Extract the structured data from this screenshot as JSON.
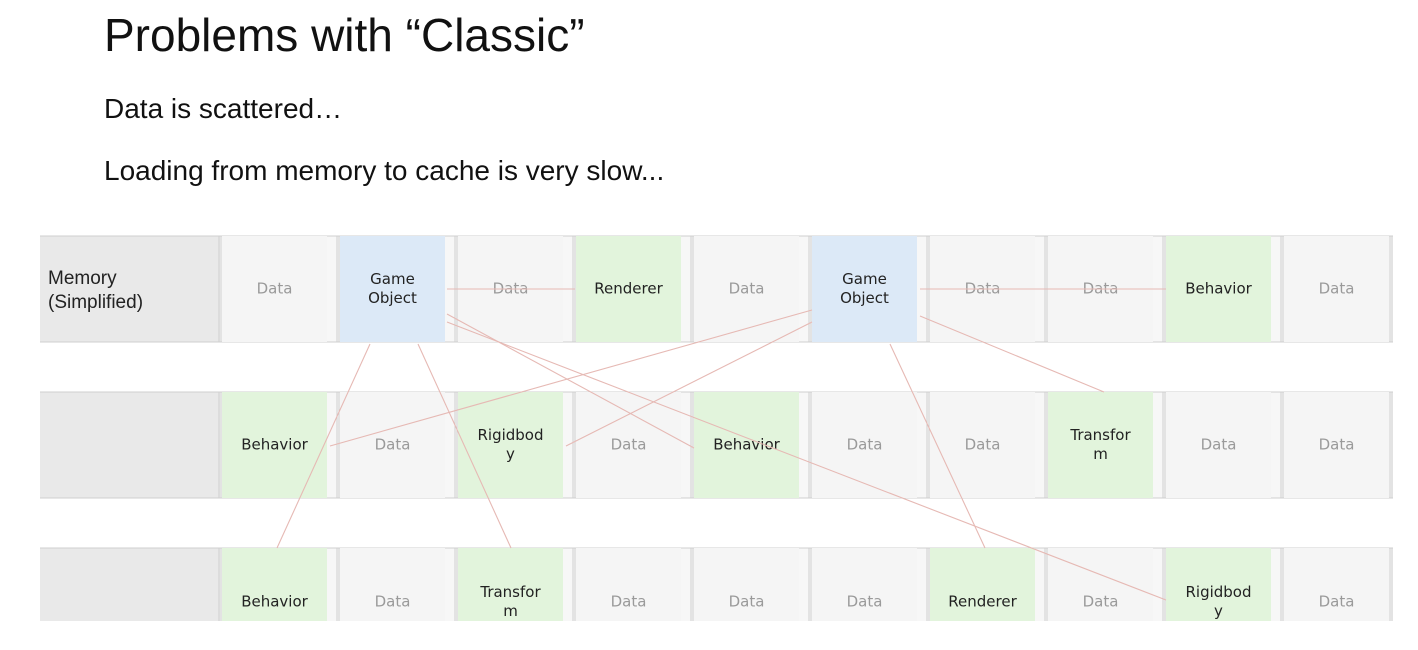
{
  "slide": {
    "title": "Problems with “Classic”",
    "bullets": [
      "Data is scattered…",
      "Loading from memory to cache is very slow..."
    ]
  },
  "diagram": {
    "row_label": [
      "Memory",
      "(Simplified)"
    ],
    "rows": [
      [
        {
          "text": "Data",
          "kind": "data"
        },
        {
          "text": "Game\nObject",
          "kind": "object"
        },
        {
          "text": "Data",
          "kind": "data"
        },
        {
          "text": "Renderer",
          "kind": "component"
        },
        {
          "text": "Data",
          "kind": "data"
        },
        {
          "text": "Game\nObject",
          "kind": "object"
        },
        {
          "text": "Data",
          "kind": "data"
        },
        {
          "text": "Data",
          "kind": "data"
        },
        {
          "text": "Behavior",
          "kind": "component"
        },
        {
          "text": "Data",
          "kind": "data"
        }
      ],
      [
        {
          "text": "Behavior",
          "kind": "component"
        },
        {
          "text": "Data",
          "kind": "data"
        },
        {
          "text": "Rigidbod\ny",
          "kind": "component"
        },
        {
          "text": "Data",
          "kind": "data"
        },
        {
          "text": "Behavior",
          "kind": "component"
        },
        {
          "text": "Data",
          "kind": "data"
        },
        {
          "text": "Data",
          "kind": "data"
        },
        {
          "text": "Transfor\nm",
          "kind": "component"
        },
        {
          "text": "Data",
          "kind": "data"
        },
        {
          "text": "Data",
          "kind": "data"
        }
      ],
      [
        {
          "text": "Behavior",
          "kind": "component"
        },
        {
          "text": "Data",
          "kind": "data"
        },
        {
          "text": "Transfor\nm",
          "kind": "component"
        },
        {
          "text": "Data",
          "kind": "data"
        },
        {
          "text": "Data",
          "kind": "data"
        },
        {
          "text": "Data",
          "kind": "data"
        },
        {
          "text": "Renderer",
          "kind": "component"
        },
        {
          "text": "Data",
          "kind": "data"
        },
        {
          "text": "Rigidbod\ny",
          "kind": "component"
        },
        {
          "text": "Data",
          "kind": "data"
        }
      ]
    ],
    "colors": {
      "data": "#f5f5f5",
      "object": "#dce9f7",
      "component": "#e2f4dc",
      "label": "#e9e9e9",
      "pointer": "#e6b9b4"
    }
  }
}
